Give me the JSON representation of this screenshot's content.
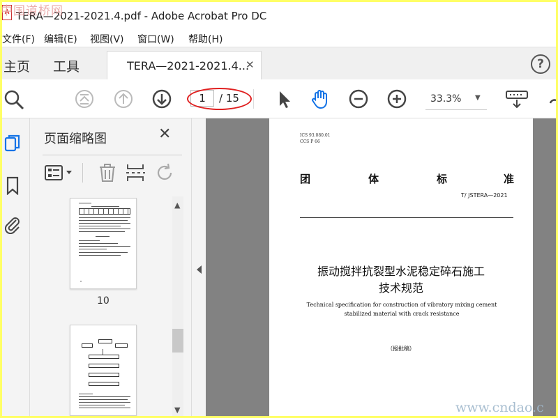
{
  "window": {
    "title": "TERA—2021-2021.4.pdf - Adobe Acrobat Pro DC",
    "watermark": "中国道桥网"
  },
  "menu": [
    "文件(F)",
    "编辑(E)",
    "视图(V)",
    "窗口(W)",
    "帮助(H)"
  ],
  "tabs": {
    "home": "主页",
    "tools": "工具",
    "document": "TERA—2021-2021.4...",
    "close": "✕",
    "help": "?"
  },
  "toolbar": {
    "current_page": "1",
    "total_pages": "/ 15",
    "zoom": "33.3%",
    "annotation_color": "#e02020"
  },
  "thumbnails": {
    "title": "页面缩略图",
    "close": "✕",
    "page_label": "10"
  },
  "document": {
    "ics": "ICS  93.080.01",
    "ccs": "CCS P 66",
    "standard_type": [
      "团",
      "体",
      "标",
      "准"
    ],
    "code": "T/  JSTERA—2021",
    "title_cn_line1": "振动搅拌抗裂型水泥稳定碎石施工",
    "title_cn_line2": "技术规范",
    "title_en": "Technical specification for construction of vibratory mixing cement stabilized material with crack resistance",
    "status": "（报批稿）"
  },
  "footer": {
    "watermark": "www.cndao.c"
  },
  "colors": {
    "frame": "#ffff66",
    "accent": "#1473e6",
    "doc_bg": "#828282"
  }
}
